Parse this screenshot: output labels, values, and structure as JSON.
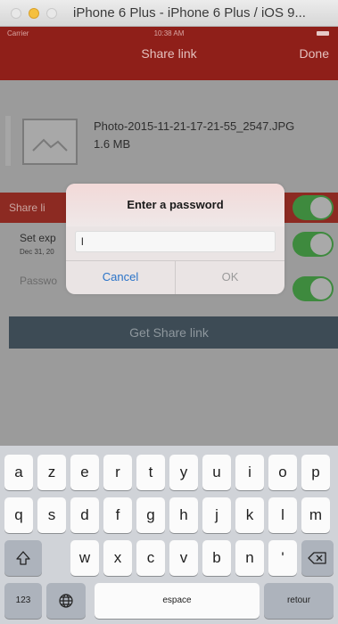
{
  "simulator": {
    "title": "iPhone 6 Plus - iPhone 6 Plus / iOS 9..."
  },
  "status_bar": {
    "carrier": "Carrier",
    "time": "10:38 AM"
  },
  "nav": {
    "title": "Share link",
    "done_label": "Done"
  },
  "file": {
    "name": "Photo-2015-11-21-17-21-55_2547.JPG",
    "size": "1.6 MB"
  },
  "rows": {
    "share_label": "Share li",
    "share_enabled": true,
    "expiration_label": "Set exp",
    "expiration_date": "Dec 31, 20",
    "expiration_enabled": true,
    "password_label": "Passwo",
    "password_enabled": true
  },
  "get_share_link_label": "Get Share link",
  "alert": {
    "title": "Enter a password",
    "input_value": "l",
    "cancel_label": "Cancel",
    "ok_label": "OK"
  },
  "keyboard": {
    "row1": [
      "a",
      "z",
      "e",
      "r",
      "t",
      "y",
      "u",
      "i",
      "o",
      "p"
    ],
    "row2": [
      "q",
      "s",
      "d",
      "f",
      "g",
      "h",
      "j",
      "k",
      "l",
      "m"
    ],
    "row3": [
      "w",
      "x",
      "c",
      "v",
      "b",
      "n",
      "'"
    ],
    "numbers_label": "123",
    "space_label": "espace",
    "return_label": "retour",
    "shift_icon": "shift-icon",
    "delete_icon": "delete-icon",
    "globe_icon": "globe-icon"
  },
  "colors": {
    "nav_bar": "#8f1f19",
    "toggle_on": "#3e8a3e",
    "alert_button": "#2a73c8",
    "share_button_bar": "#3d4b55"
  }
}
